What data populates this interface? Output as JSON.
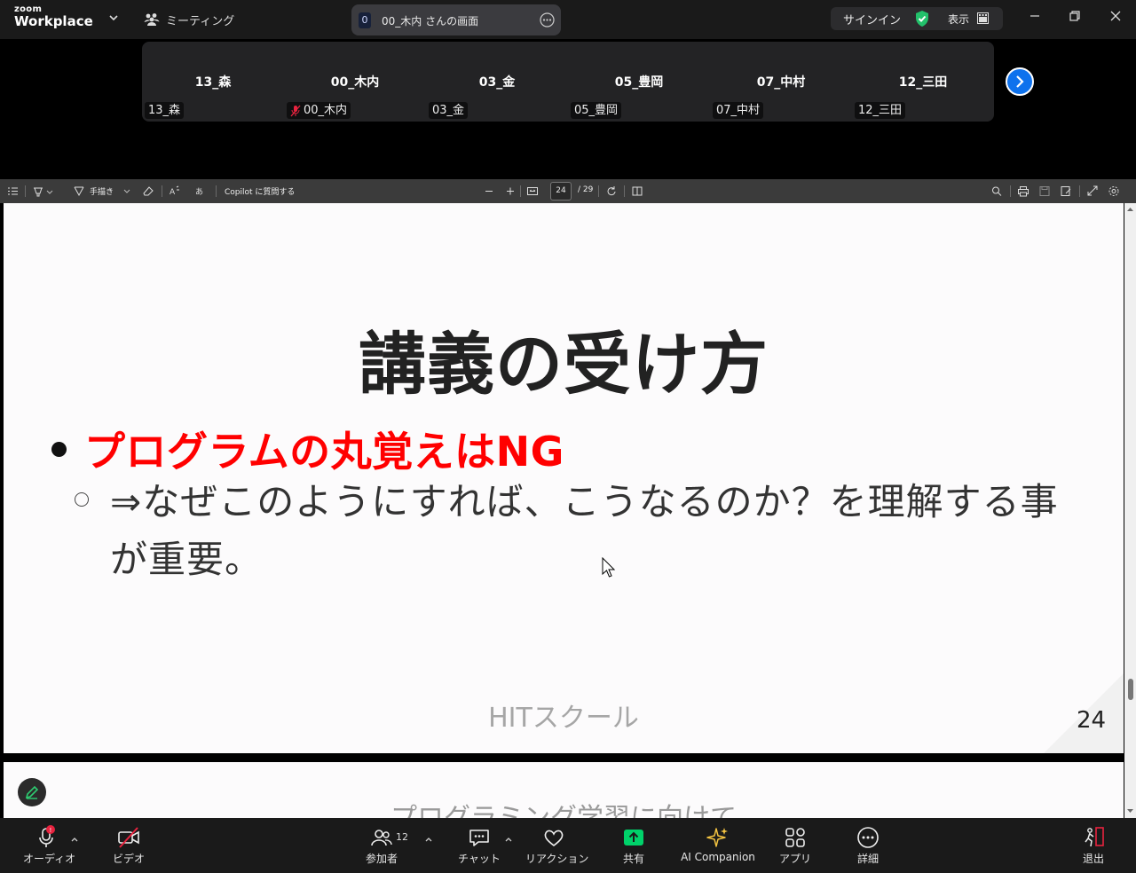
{
  "app": {
    "logo_line1": "zoom",
    "logo_line2": "Workplace",
    "meeting_label": "ミーティング",
    "screen_badge": "0",
    "screen_title": "00_木内 さんの画面",
    "signin": "サインイン",
    "view": "表示"
  },
  "participants": [
    {
      "big": "13_森",
      "small": "13_森",
      "muted": false
    },
    {
      "big": "00_木内",
      "small": "00_木内",
      "muted": true
    },
    {
      "big": "03_金",
      "small": "03_金",
      "muted": false
    },
    {
      "big": "05_豊岡",
      "small": "05_豊岡",
      "muted": false
    },
    {
      "big": "07_中村",
      "small": "07_中村",
      "muted": false
    },
    {
      "big": "12_三田",
      "small": "12_三田",
      "muted": false
    }
  ],
  "pdf_toolbar": {
    "draw_label": "手描き",
    "copilot_label": "Copilot に質問する",
    "page_current": "24",
    "page_total": "/ 29"
  },
  "slide": {
    "title": "講義の受け方",
    "bullet1": "プログラムの丸覚えはNG",
    "bullet2": "⇒なぜこのようにすれば、こうなるのか？を理解する事が重要。",
    "footer": "HITスクール",
    "page_number": "24"
  },
  "next_slide": {
    "peek_title": "プログラミング学習に向けて"
  },
  "bottom_bar": {
    "audio": "オーディオ",
    "video": "ビデオ",
    "participants": "参加者",
    "participants_count": "12",
    "chat": "チャット",
    "reactions": "リアクション",
    "share": "共有",
    "ai_companion": "AI Companion",
    "apps": "アプリ",
    "more": "詳細",
    "leave": "退出"
  },
  "colors": {
    "accent_blue": "#0e72ed",
    "share_green": "#00d26a",
    "title_red": "#ff0000",
    "alert_red": "#e8233f"
  }
}
